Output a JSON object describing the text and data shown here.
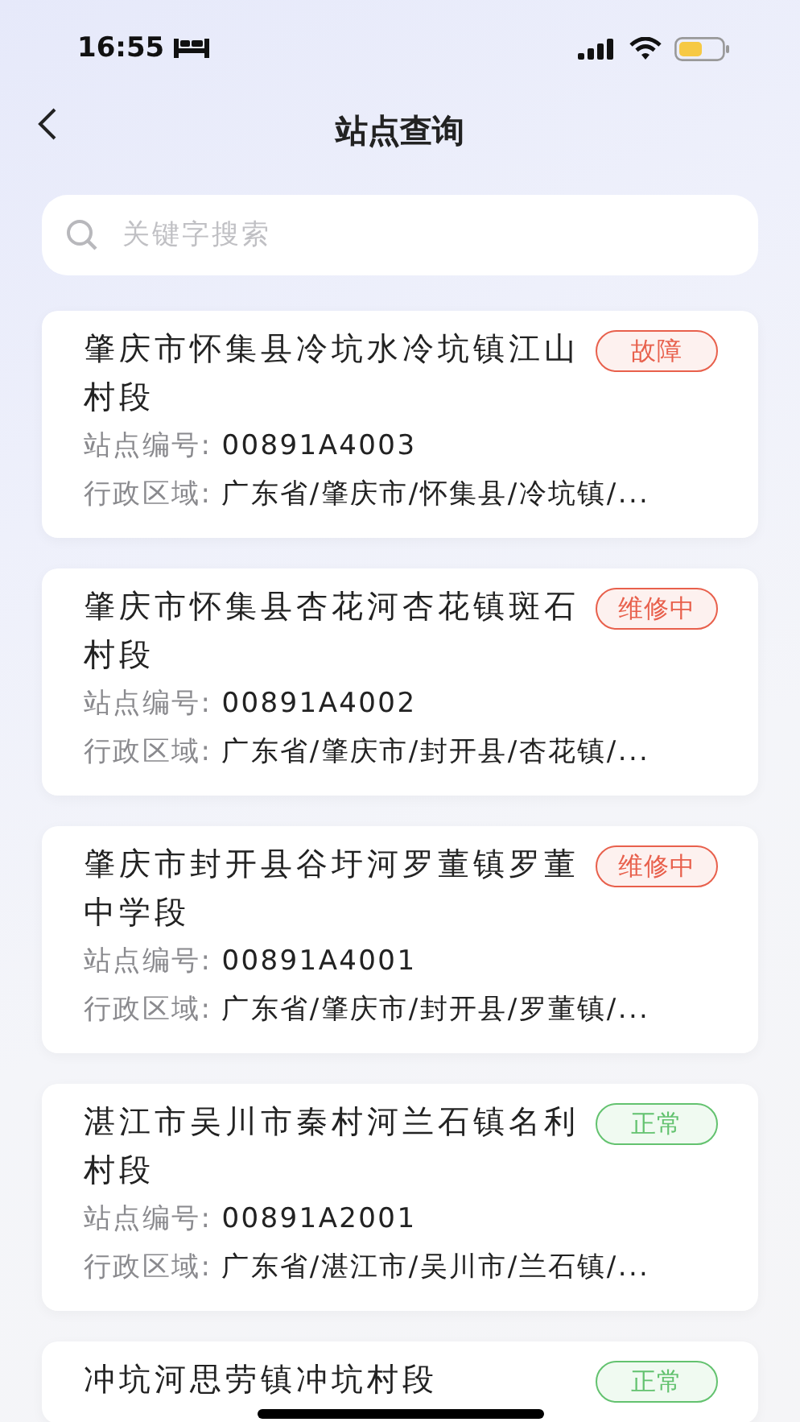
{
  "status_bar": {
    "time": "16:55"
  },
  "nav": {
    "title": "站点查询"
  },
  "search": {
    "placeholder": "关键字搜索"
  },
  "stations": [
    {
      "title": "肇庆市怀集县冷坑水冷坑镇江山村段",
      "status": {
        "label": "故障",
        "kind": "fault"
      },
      "code_label": "站点编号:",
      "code": "00891A4003",
      "region_label": "行政区域:",
      "region": "广东省/肇庆市/怀集县/冷坑镇/..."
    },
    {
      "title": "肇庆市怀集县杏花河杏花镇斑石村段",
      "status": {
        "label": "维修中",
        "kind": "repair"
      },
      "code_label": "站点编号:",
      "code": "00891A4002",
      "region_label": "行政区域:",
      "region": "广东省/肇庆市/封开县/杏花镇/..."
    },
    {
      "title": "肇庆市封开县谷圩河罗董镇罗董中学段",
      "status": {
        "label": "维修中",
        "kind": "repair"
      },
      "code_label": "站点编号:",
      "code": "00891A4001",
      "region_label": "行政区域:",
      "region": "广东省/肇庆市/封开县/罗董镇/..."
    },
    {
      "title": "湛江市吴川市秦村河兰石镇名利村段",
      "status": {
        "label": "正常",
        "kind": "normal"
      },
      "code_label": "站点编号:",
      "code": "00891A2001",
      "region_label": "行政区域:",
      "region": "广东省/湛江市/吴川市/兰石镇/..."
    },
    {
      "title": "冲坑河思劳镇冲坑村段",
      "status": {
        "label": "正常",
        "kind": "normal"
      }
    }
  ]
}
